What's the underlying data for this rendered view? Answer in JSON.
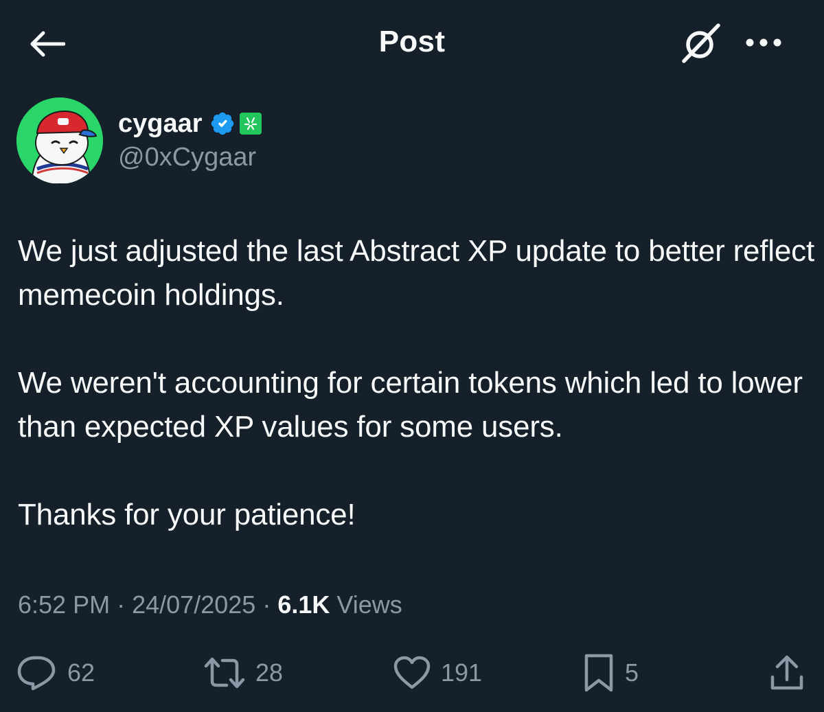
{
  "header": {
    "title": "Post",
    "back_icon": "arrow-left-icon",
    "grok_icon": "grok-icon",
    "more_icon": "more-horizontal-icon"
  },
  "author": {
    "display_name": "cygaar",
    "handle": "@0xCygaar",
    "verified_icon": "verified-badge-icon",
    "affiliate_badge_icon": "abstract-affiliate-badge-icon",
    "avatar_background": "#2ad66a"
  },
  "post": {
    "paragraphs": [
      "We just adjusted the last Abstract XP update to better reflect memecoin holdings.",
      "We weren't accounting for certain tokens which led to lower than expected XP values for some users.",
      "Thanks for your patience!"
    ]
  },
  "meta": {
    "time": "6:52 PM",
    "separator": "·",
    "date": "24/07/2025",
    "views_count": "6.1K",
    "views_label": "Views"
  },
  "actions": {
    "replies": {
      "icon": "reply-icon",
      "count": "62"
    },
    "reposts": {
      "icon": "repost-icon",
      "count": "28"
    },
    "likes": {
      "icon": "heart-icon",
      "count": "191"
    },
    "bookmarks": {
      "icon": "bookmark-icon",
      "count": "5"
    },
    "share": {
      "icon": "share-icon"
    }
  },
  "colors": {
    "background": "#15202b",
    "text_primary": "#f7f9f9",
    "text_secondary": "#8b98a5",
    "verified_blue": "#1d9bf0",
    "affiliate_green": "#23c65c"
  }
}
